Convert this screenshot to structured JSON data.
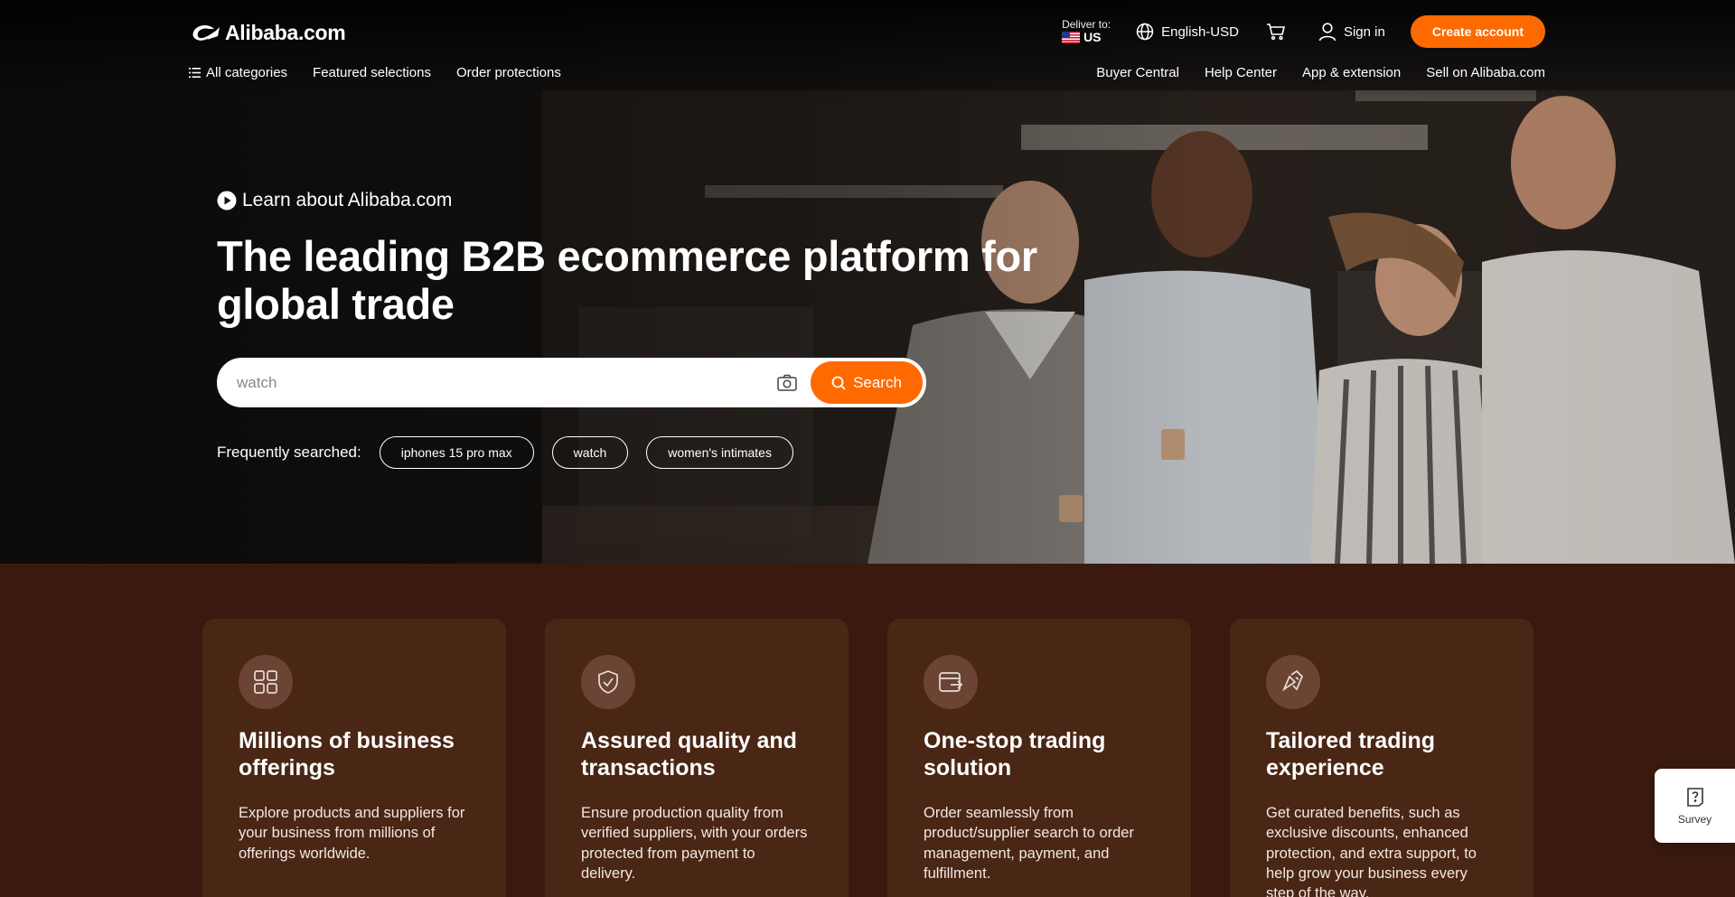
{
  "header": {
    "logo_text": "Alibaba.com",
    "deliver_label": "Deliver to:",
    "deliver_country": "US",
    "language": "English-USD",
    "sign_in": "Sign in",
    "create_account": "Create account"
  },
  "nav_left": [
    {
      "label": "All categories"
    },
    {
      "label": "Featured selections"
    },
    {
      "label": "Order protections"
    }
  ],
  "nav_right": [
    {
      "label": "Buyer Central"
    },
    {
      "label": "Help Center"
    },
    {
      "label": "App & extension"
    },
    {
      "label": "Sell on Alibaba.com"
    }
  ],
  "hero": {
    "learn_link": "Learn about Alibaba.com",
    "headline": "The leading B2B ecommerce platform for global trade",
    "search_placeholder": "watch",
    "search_button": "Search",
    "frequently_label": "Frequently searched:",
    "chips": [
      "iphones 15 pro max",
      "watch",
      "women's intimates"
    ]
  },
  "features": [
    {
      "icon": "grid-icon",
      "title": "Millions of business offerings",
      "text": "Explore products and suppliers for your business from millions of offerings worldwide."
    },
    {
      "icon": "shield-check-icon",
      "title": "Assured quality and transactions",
      "text": "Ensure production quality from verified suppliers, with your orders protected from payment to delivery."
    },
    {
      "icon": "trading-box-icon",
      "title": "One-stop trading solution",
      "text": "Order seamlessly from product/supplier search to order management, payment, and fulfillment."
    },
    {
      "icon": "tailored-icon",
      "title": "Tailored trading experience",
      "text": "Get curated benefits, such as exclusive discounts, enhanced protection, and extra support, to help grow your business every step of the way."
    }
  ],
  "survey": {
    "label": "Survey"
  },
  "colors": {
    "accent": "#ff6a00",
    "section_bg": "#3a1a0e",
    "card_bg": "#4a2615"
  }
}
